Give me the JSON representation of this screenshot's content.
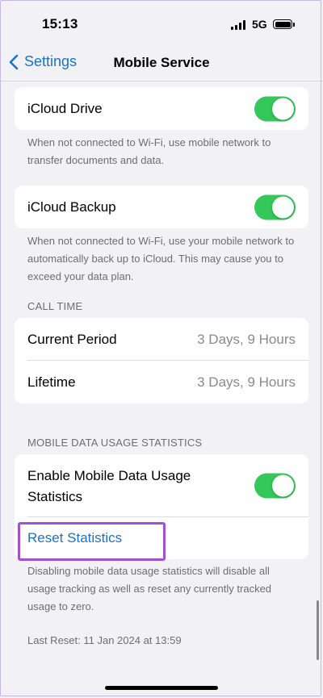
{
  "status": {
    "time": "15:13",
    "network": "5G"
  },
  "nav": {
    "back_label": "Settings",
    "title": "Mobile Service"
  },
  "icloud_drive": {
    "label": "iCloud Drive",
    "enabled": true,
    "footnote": "When not connected to Wi-Fi, use mobile network to transfer documents and data."
  },
  "icloud_backup": {
    "label": "iCloud Backup",
    "enabled": true,
    "footnote": "When not connected to Wi-Fi, use your mobile network to automatically back up to iCloud. This may cause you to exceed your data plan."
  },
  "call_time": {
    "header": "CALL TIME",
    "rows": [
      {
        "label": "Current Period",
        "value": "3 Days, 9 Hours"
      },
      {
        "label": "Lifetime",
        "value": "3 Days, 9 Hours"
      }
    ]
  },
  "usage_stats": {
    "header": "MOBILE DATA USAGE STATISTICS",
    "enable_label": "Enable Mobile Data Usage Statistics",
    "enabled": true,
    "reset_label": "Reset Statistics",
    "footnote": "Disabling mobile data usage statistics will disable all usage tracking as well as reset any currently tracked usage to zero.",
    "last_reset": "Last Reset: 11 Jan 2024 at 13:59"
  },
  "colors": {
    "accent": "#1a73c8",
    "toggle_on": "#34c759",
    "highlight": "#a050d0"
  }
}
